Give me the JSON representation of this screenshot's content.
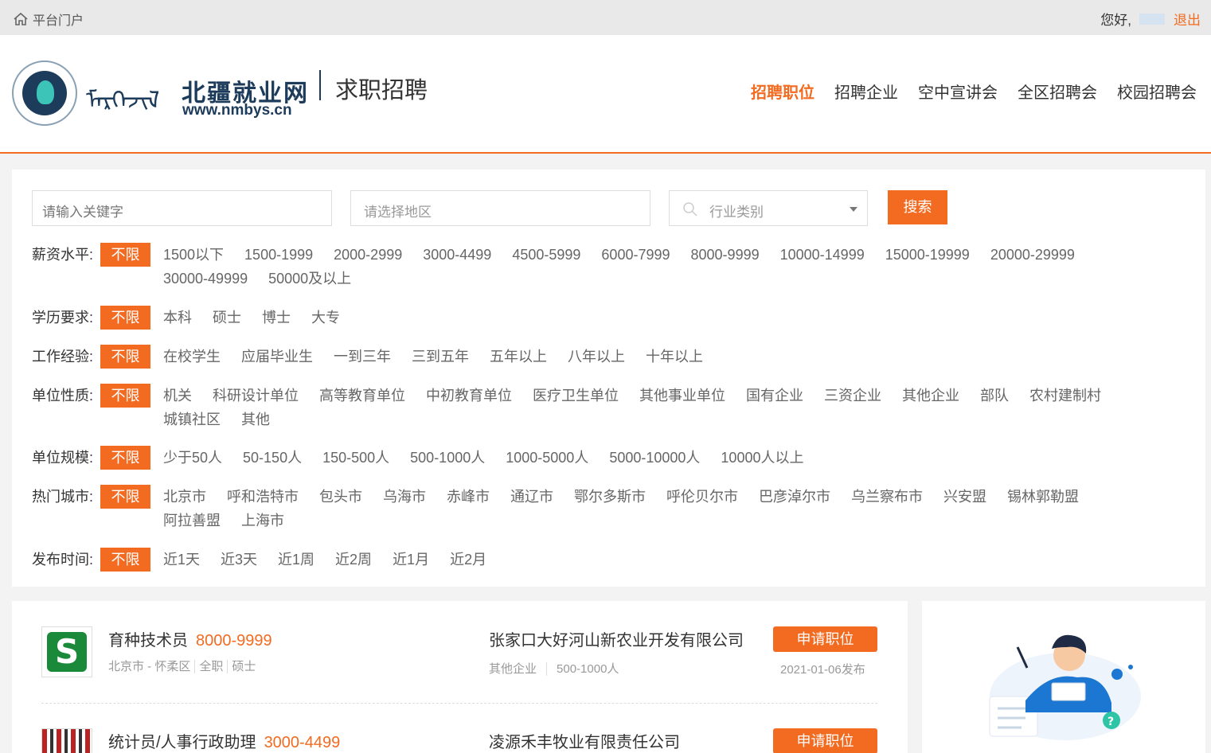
{
  "topbar": {
    "portal_label": "平台门户",
    "greeting": "您好,",
    "logout_label": "退出"
  },
  "header": {
    "mongol_text": "ᠮᠡᠷᠭᠡᠵᠢᠯ",
    "site_name": "北疆就业网",
    "site_url": "www.nmbys.cn",
    "subtitle": "求职招聘",
    "nav": [
      "招聘职位",
      "招聘企业",
      "空中宣讲会",
      "全区招聘会",
      "校园招聘会"
    ],
    "active_nav": "招聘职位"
  },
  "search": {
    "keyword_placeholder": "请输入关键字",
    "region_placeholder": "请选择地区",
    "industry_placeholder": "行业类别",
    "button_label": "搜索"
  },
  "filters": [
    {
      "label": "薪资水平:",
      "nolimit": "不限",
      "options": [
        "1500以下",
        "1500-1999",
        "2000-2999",
        "3000-4499",
        "4500-5999",
        "6000-7999",
        "8000-9999",
        "10000-14999",
        "15000-19999",
        "20000-29999",
        "30000-49999",
        "50000及以上"
      ]
    },
    {
      "label": "学历要求:",
      "nolimit": "不限",
      "options": [
        "本科",
        "硕士",
        "博士",
        "大专"
      ]
    },
    {
      "label": "工作经验:",
      "nolimit": "不限",
      "options": [
        "在校学生",
        "应届毕业生",
        "一到三年",
        "三到五年",
        "五年以上",
        "八年以上",
        "十年以上"
      ]
    },
    {
      "label": "单位性质:",
      "nolimit": "不限",
      "options": [
        "机关",
        "科研设计单位",
        "高等教育单位",
        "中初教育单位",
        "医疗卫生单位",
        "其他事业单位",
        "国有企业",
        "三资企业",
        "其他企业",
        "部队",
        "农村建制村",
        "城镇社区",
        "其他"
      ]
    },
    {
      "label": "单位规模:",
      "nolimit": "不限",
      "options": [
        "少于50人",
        "50-150人",
        "150-500人",
        "500-1000人",
        "1000-5000人",
        "5000-10000人",
        "10000人以上"
      ]
    },
    {
      "label": "热门城市:",
      "nolimit": "不限",
      "options": [
        "北京市",
        "呼和浩特市",
        "包头市",
        "乌海市",
        "赤峰市",
        "通辽市",
        "鄂尔多斯市",
        "呼伦贝尔市",
        "巴彦淖尔市",
        "乌兰察布市",
        "兴安盟",
        "锡林郭勒盟",
        "阿拉善盟",
        "上海市"
      ]
    },
    {
      "label": "发布时间:",
      "nolimit": "不限",
      "options": [
        "近1天",
        "近3天",
        "近1周",
        "近2周",
        "近1月",
        "近2月"
      ]
    }
  ],
  "jobs": [
    {
      "title": "育种技术员",
      "salary": "8000-9999",
      "location": "北京市 - 怀柔区",
      "type": "全职",
      "education": "硕士",
      "company": "张家口大好河山新农业开发有限公司",
      "company_type": "其他企业",
      "company_size": "500-1000人",
      "apply_label": "申请职位",
      "date": "2021-01-06发布"
    },
    {
      "title": "统计员/人事行政助理",
      "salary": "3000-4499",
      "company": "凌源禾丰牧业有限责任公司",
      "apply_label": "申请职位"
    }
  ],
  "colors": {
    "accent": "#f26b21",
    "brand_dark": "#1d3b5a"
  }
}
